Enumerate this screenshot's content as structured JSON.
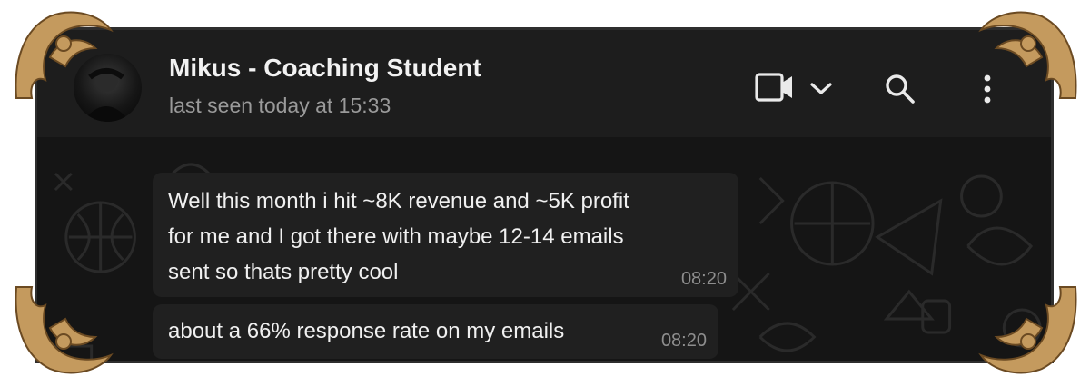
{
  "chat": {
    "contact_name": "Mikus - Coaching Student",
    "status": "last seen today at 15:33"
  },
  "icons": {
    "call": "video-camera-icon",
    "call_menu": "chevron-down-icon",
    "search": "search-icon",
    "menu": "kebab-menu-icon"
  },
  "messages": [
    {
      "lines": [
        "Well this month i hit ~8K revenue and ~5K profit",
        "for me and I got there with maybe 12-14 emails",
        "sent so thats pretty cool"
      ],
      "time": "08:20"
    },
    {
      "lines": [
        "about a 66% response rate on my emails"
      ],
      "time": "08:20"
    }
  ],
  "colors": {
    "background": "#151515",
    "header": "#1d1d1d",
    "bubble": "#202020",
    "ornament": "#c49a5e"
  }
}
